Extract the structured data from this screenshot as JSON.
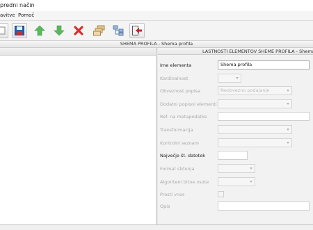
{
  "window": {
    "title": "predni način"
  },
  "menu": {
    "items": [
      "avitve",
      "Pomoč"
    ]
  },
  "toolbar": {
    "buttons": [
      {
        "icon": "window-icon"
      },
      {
        "icon": "save-icon"
      },
      {
        "icon": "arrow-up-icon"
      },
      {
        "icon": "arrow-down-icon"
      },
      {
        "icon": "delete-icon"
      },
      {
        "icon": "stack-icon"
      },
      {
        "icon": "hierarchy-icon"
      },
      {
        "icon": "exit-icon"
      }
    ],
    "colors": {
      "up": "#5cb85c",
      "down": "#5cb85c",
      "delete": "#d9302c",
      "save": "#2f5f9e",
      "exit": "#c0282b"
    }
  },
  "left_panel": {
    "title": "SHEMA PROFILA - Shema profila"
  },
  "right_panel": {
    "title": "LASTNOSTI ELEMENTOV SHEME PROFILA - Shema profila",
    "fields": [
      {
        "label": "Ime elementa",
        "value": "Shema profila",
        "enabled": true,
        "type": "text"
      },
      {
        "label": "Kardinalnost",
        "value": "",
        "enabled": false,
        "type": "select-small"
      },
      {
        "label": "Obveznost popisa",
        "value": "Neobvezno podajanje",
        "enabled": false,
        "type": "select"
      },
      {
        "label": "Dodatni popisni elementi",
        "value": "",
        "enabled": false,
        "type": "select"
      },
      {
        "label": "Ref. na metapodatke",
        "value": "",
        "enabled": false,
        "type": "text"
      },
      {
        "label": "Transformacija",
        "value": "",
        "enabled": false,
        "type": "select"
      },
      {
        "label": "Kontrolni seznam",
        "value": "",
        "enabled": false,
        "type": "select"
      },
      {
        "label": "Največje št. datotek",
        "value": "",
        "enabled": false,
        "type": "text-small"
      },
      {
        "label": "Format sličenja",
        "value": "",
        "enabled": false,
        "type": "select-medium"
      },
      {
        "label": "Algoritem bitne vsote",
        "value": "",
        "enabled": false,
        "type": "select-medium"
      },
      {
        "label": "Prosti vnos",
        "value": "",
        "enabled": false,
        "type": "checkbox"
      },
      {
        "label": "Opis",
        "value": "",
        "enabled": false,
        "type": "text"
      }
    ]
  }
}
